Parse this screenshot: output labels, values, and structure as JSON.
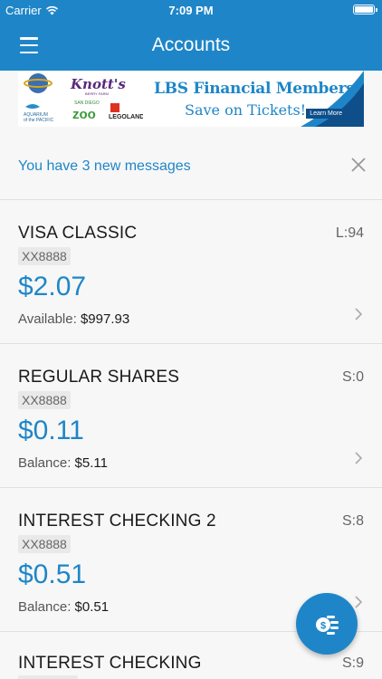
{
  "status_bar": {
    "carrier": "Carrier",
    "time": "7:09 PM"
  },
  "nav": {
    "title": "Accounts"
  },
  "banner": {
    "title": "LBS Financial Members",
    "subtitle": "Save on Tickets!",
    "cta": "Learn More",
    "logos": [
      "UNIVERSAL STUDIOS",
      "Knott's",
      "AQUARIUM OF THE PACIFIC",
      "SAN DIEGO ZOO",
      "LEGOLAND"
    ]
  },
  "messages": {
    "text": "You have 3 new messages"
  },
  "accounts": [
    {
      "name": "VISA CLASSIC",
      "code": "L:94",
      "mask": "XX8888",
      "amount": "$2.07",
      "detail_label": "Available:",
      "detail_value": "$997.93"
    },
    {
      "name": "REGULAR SHARES",
      "code": "S:0",
      "mask": "XX8888",
      "amount": "$0.11",
      "detail_label": "Balance:",
      "detail_value": "$5.11"
    },
    {
      "name": "INTEREST CHECKING 2",
      "code": "S:8",
      "mask": "XX8888",
      "amount": "$0.51",
      "detail_label": "Balance:",
      "detail_value": "$0.51"
    },
    {
      "name": "INTEREST CHECKING",
      "code": "S:9"
    }
  ],
  "colors": {
    "primary": "#1e86c8",
    "background": "#f7f7f7"
  },
  "icons": {
    "menu": "hamburger-icon",
    "close": "close-icon",
    "chevron": "chevron-right-icon",
    "fab": "transfer-money-icon"
  }
}
